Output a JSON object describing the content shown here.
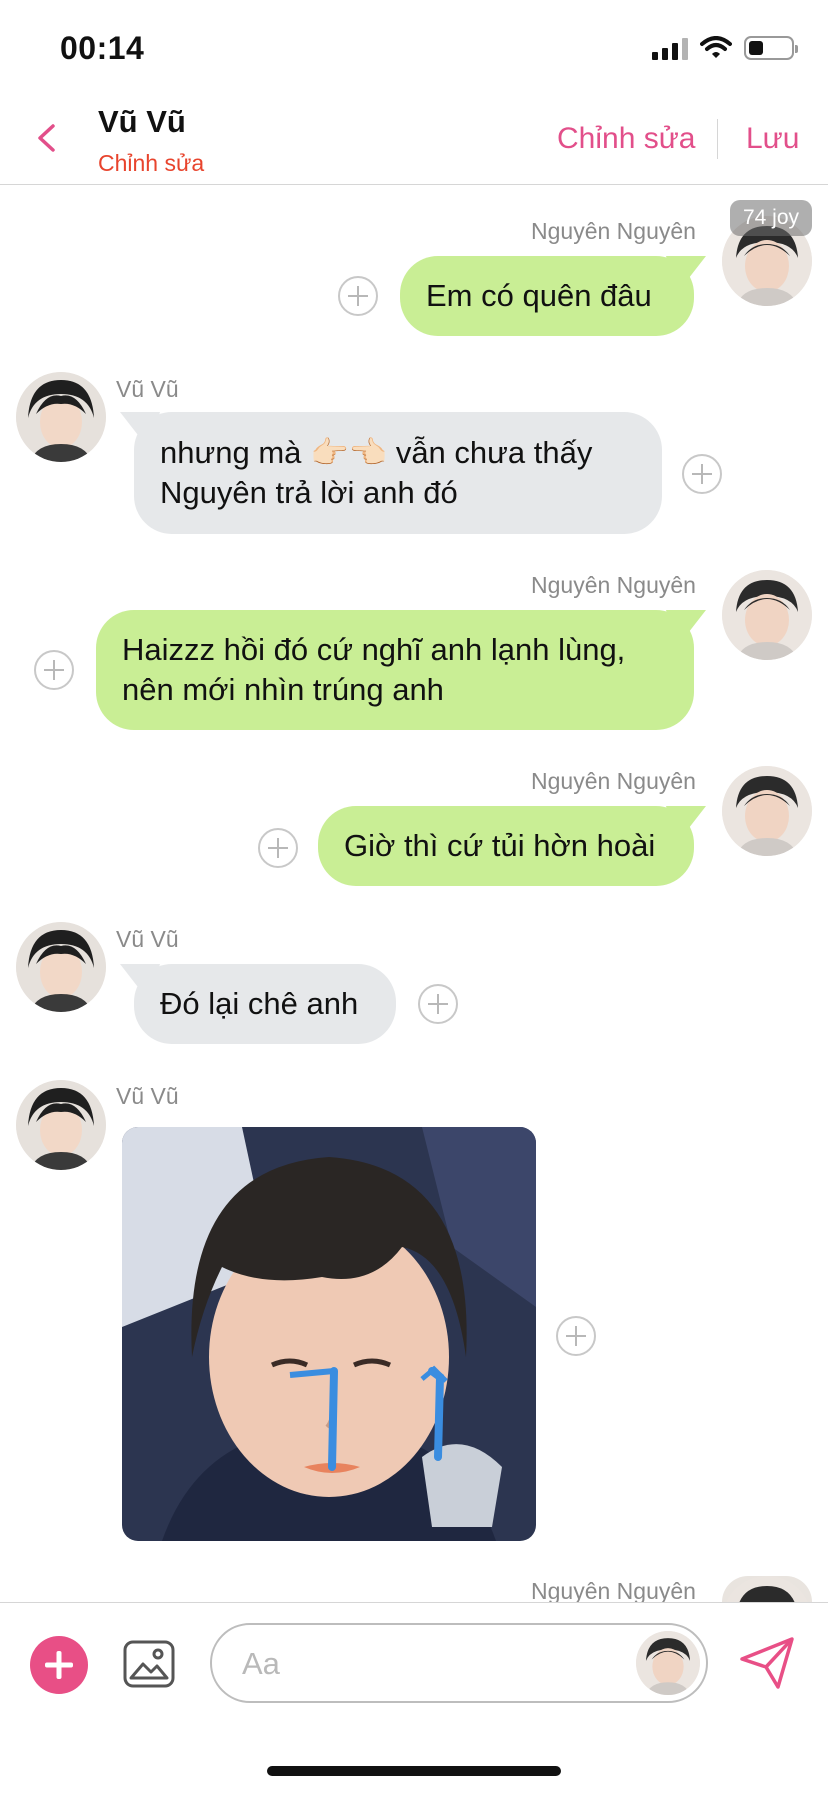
{
  "status_bar": {
    "time": "00:14",
    "battery_level": 0.3
  },
  "header": {
    "name": "Vũ Vũ",
    "subtitle": "Chỉnh sửa",
    "edit_label": "Chỉnh sửa",
    "save_label": "Lưu"
  },
  "overlay_badge": "74 joy",
  "messages": [
    {
      "sender": "Nguyên Nguyên",
      "direction": "out",
      "text": "Em có quên đâu"
    },
    {
      "sender": "Vũ Vũ",
      "direction": "in",
      "text": "nhưng mà 👉🏻👈🏻 vẫn chưa thấy Nguyên trả lời anh đó"
    },
    {
      "sender": "Nguyên Nguyên",
      "direction": "out",
      "text": "Haizzz hồi đó cứ nghĩ anh lạnh lùng, nên mới nhìn trúng anh"
    },
    {
      "sender": "Nguyên Nguyên",
      "direction": "out",
      "text": "Giờ thì cứ tủi hờn hoài"
    },
    {
      "sender": "Vũ Vũ",
      "direction": "in",
      "text": "Đó lại chê anh"
    },
    {
      "sender": "Vũ Vũ",
      "direction": "in",
      "type": "image"
    },
    {
      "sender": "Nguyên Nguyên",
      "direction": "out"
    }
  ],
  "composer": {
    "placeholder": "Aa"
  },
  "colors": {
    "accent": "#e84f86",
    "outgoing_bubble": "#c9ee95",
    "incoming_bubble": "#e6e8ea",
    "subtitle": "#e8442d"
  }
}
